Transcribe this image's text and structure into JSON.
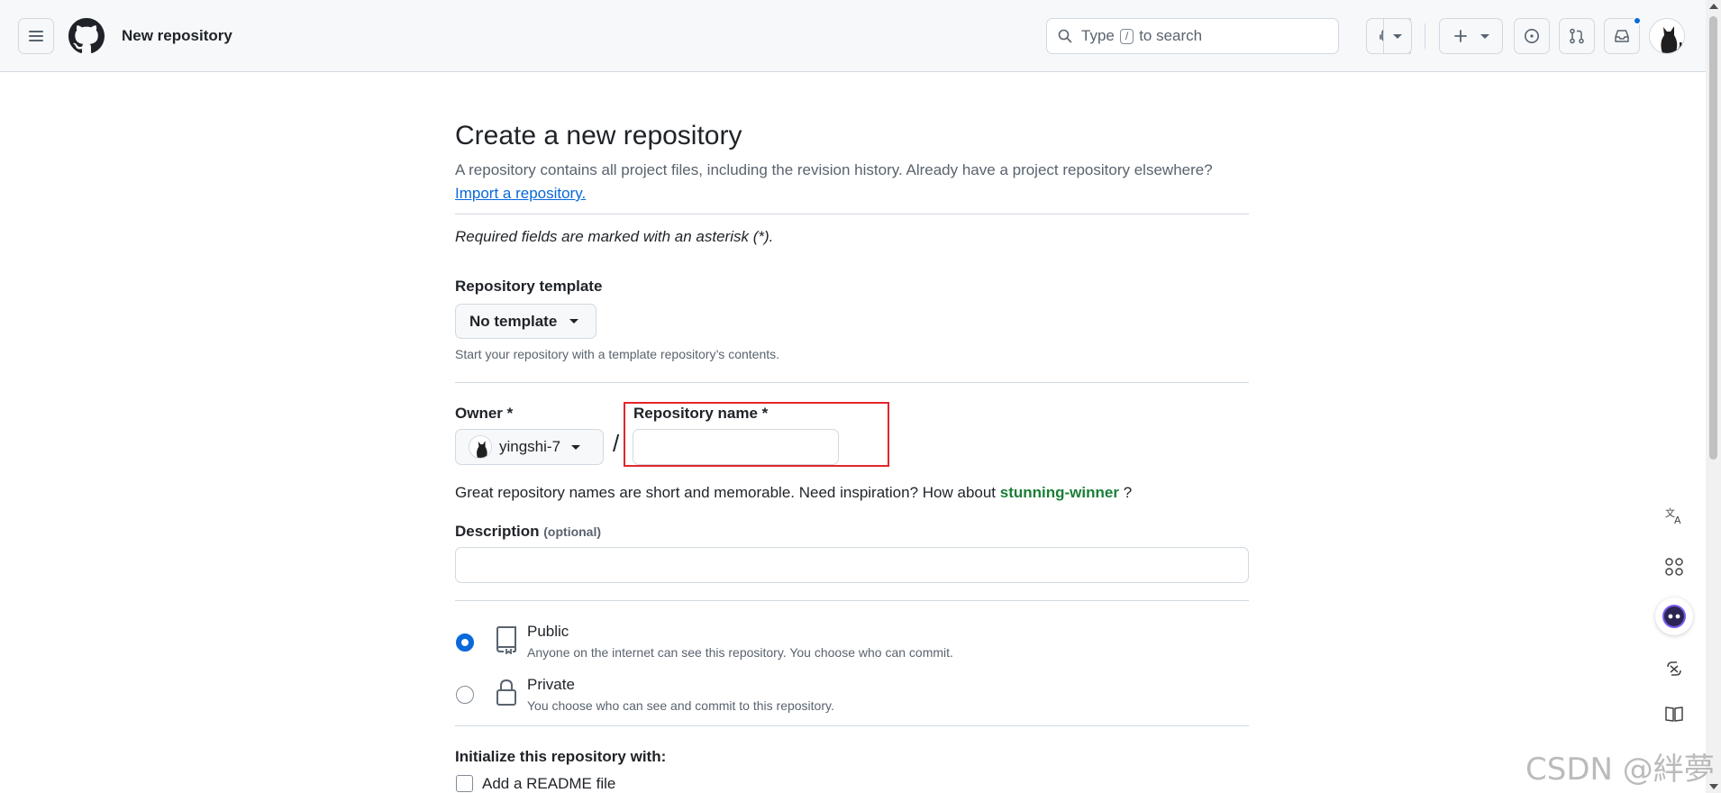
{
  "header": {
    "page_context": "New repository",
    "search": {
      "prefix": "Type",
      "key": "/",
      "suffix": "to search"
    }
  },
  "main": {
    "title": "Create a new repository",
    "description": "A repository contains all project files, including the revision history. Already have a project repository elsewhere?",
    "import_link": "Import a repository.",
    "required_note": "Required fields are marked with an asterisk (*).",
    "template": {
      "label": "Repository template",
      "selected": "No template",
      "hint": "Start your repository with a template repository’s contents."
    },
    "owner": {
      "label": "Owner *",
      "selected": "yingshi-7"
    },
    "slash": "/",
    "repo_name": {
      "label": "Repository name *",
      "value": ""
    },
    "inspiration": {
      "text": "Great repository names are short and memorable. Need inspiration? How about",
      "suggestion": "stunning-winner",
      "suffix": "?"
    },
    "description_field": {
      "label": "Description",
      "optional": "(optional)",
      "value": ""
    },
    "visibility": {
      "public": {
        "title": "Public",
        "subtitle": "Anyone on the internet can see this repository. You choose who can commit.",
        "checked": true
      },
      "private": {
        "title": "Private",
        "subtitle": "You choose who can see and commit to this repository.",
        "checked": false
      }
    },
    "initialize": {
      "label": "Initialize this repository with:",
      "readme": {
        "label": "Add a README file",
        "checked": false
      }
    }
  },
  "sidebar_tools": [
    "translate-icon",
    "apps-icon",
    "assistant-icon",
    "screenshot-translate-icon",
    "reader-icon"
  ],
  "watermark": "CSDN @絆夢",
  "colors": {
    "accent": "#0969da",
    "suggestion_green": "#1a7f37",
    "highlight_red": "#e3262b",
    "border": "#d1d9e0",
    "header_bg": "#f6f8fa"
  }
}
